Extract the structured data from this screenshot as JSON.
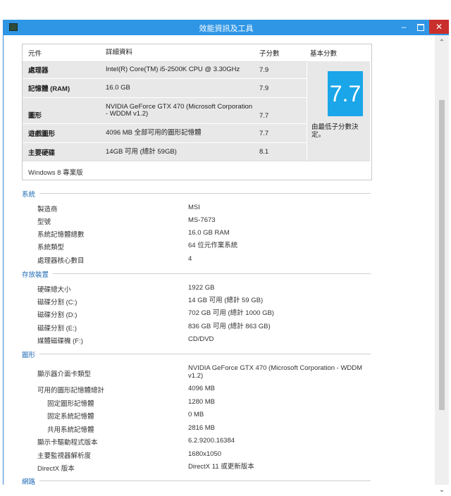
{
  "window": {
    "title": "效能資訊及工具"
  },
  "window_buttons": {
    "minimize": "–",
    "close": "✕"
  },
  "scroll": {
    "up": "⌃",
    "down": "⌄"
  },
  "score_table": {
    "headers": {
      "component": "元件",
      "details": "詳細資料",
      "subscore": "子分數",
      "base": "基本分數"
    },
    "rows": [
      {
        "component": "處理器",
        "details": "Intel(R) Core(TM) i5-2500K CPU @ 3.30GHz",
        "subscore": "7.9"
      },
      {
        "component": "記憶體 (RAM)",
        "details": "16.0 GB",
        "subscore": "7.9"
      },
      {
        "component": "圖形",
        "details": "NVIDIA GeForce GTX 470 (Microsoft Corporation - WDDM v1.2)",
        "subscore": "7.7"
      },
      {
        "component": "遊戲圖形",
        "details": "4096 MB 全部可用的圖形記憶體",
        "subscore": "7.7"
      },
      {
        "component": "主要硬碟",
        "details": "14GB 可用 (總計 59GB)",
        "subscore": "8.1"
      }
    ],
    "base_score": "7.7",
    "base_note": "由最低子分數決定。",
    "edition": "Windows 8 專業版"
  },
  "sections": {
    "system": {
      "title": "系統",
      "rows": [
        {
          "label": "製造商",
          "value": "MSI"
        },
        {
          "label": "型號",
          "value": "MS-7673"
        },
        {
          "label": "系統記憶體總數",
          "value": "16.0 GB RAM"
        },
        {
          "label": "系統類型",
          "value": "64 位元作業系統"
        },
        {
          "label": "處理器核心數目",
          "value": "4"
        }
      ]
    },
    "storage": {
      "title": "存放裝置",
      "rows": [
        {
          "label": "硬碟總大小",
          "value": "1922 GB"
        },
        {
          "label": "磁碟分割 (C:)",
          "value": "14 GB 可用 (總計 59 GB)"
        },
        {
          "label": "磁碟分割 (D:)",
          "value": "702 GB 可用 (總計 1000 GB)"
        },
        {
          "label": "磁碟分割 (E:)",
          "value": "836 GB 可用 (總計 863 GB)"
        },
        {
          "label": "媒體磁碟機 (F:)",
          "value": "CD/DVD"
        }
      ]
    },
    "graphics": {
      "title": "圖形",
      "rows": [
        {
          "label": "顯示器介面卡類型",
          "value": "NVIDIA GeForce GTX 470 (Microsoft Corporation - WDDM v1.2)"
        },
        {
          "label": "可用的圖形記憶體總計",
          "value": "4096 MB"
        },
        {
          "label": "固定圖形記憶體",
          "value": "1280 MB"
        },
        {
          "label": "固定系統記憶體",
          "value": "0 MB"
        },
        {
          "label": "共用系統記憶體",
          "value": "2816 MB"
        },
        {
          "label": "顯示卡驅動程式版本",
          "value": "6.2.9200.16384"
        },
        {
          "label": "主要監視器解析度",
          "value": "1680x1050"
        },
        {
          "label": "DirectX 版本",
          "value": "DirectX 11 或更新版本"
        }
      ]
    },
    "network": {
      "title": "網路"
    }
  }
}
